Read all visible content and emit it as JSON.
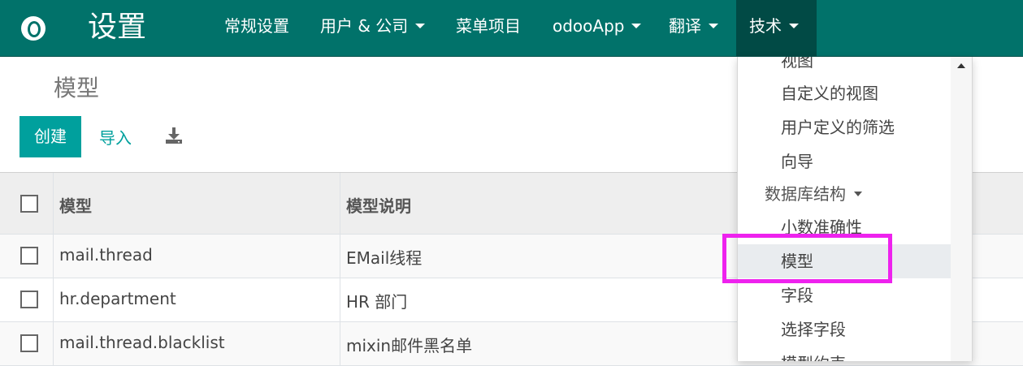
{
  "navbar": {
    "app_title": "设置",
    "items": [
      {
        "label": "常规设置",
        "dropdown": false
      },
      {
        "label": "用户 & 公司",
        "dropdown": true
      },
      {
        "label": "菜单项目",
        "dropdown": false
      },
      {
        "label": "odooApp",
        "dropdown": true
      },
      {
        "label": "翻译",
        "dropdown": true
      },
      {
        "label": "技术",
        "dropdown": true,
        "active": true
      }
    ],
    "color": "#01726a"
  },
  "control_panel": {
    "title": "模型",
    "create_label": "创建",
    "import_label": "导入",
    "download_icon": "download-icon"
  },
  "table": {
    "columns": [
      "模型",
      "模型说明"
    ],
    "rows": [
      {
        "model": "mail.thread",
        "description": "EMail线程"
      },
      {
        "model": "hr.department",
        "description": "HR 部门"
      },
      {
        "model": "mail.thread.blacklist",
        "description": "mixin邮件黑名单"
      }
    ]
  },
  "dropdown": {
    "items": [
      {
        "label": "视图"
      },
      {
        "label": "自定义的视图"
      },
      {
        "label": "用户定义的筛选"
      },
      {
        "label": "向导"
      },
      {
        "label": "数据库结构",
        "header": true
      },
      {
        "label": "小数准确性"
      },
      {
        "label": "模型",
        "selected": true
      },
      {
        "label": "字段"
      },
      {
        "label": "选择字段"
      },
      {
        "label": "模型约束"
      }
    ]
  },
  "accent_color": "#00a09d",
  "highlight_color": "#ee22ee"
}
